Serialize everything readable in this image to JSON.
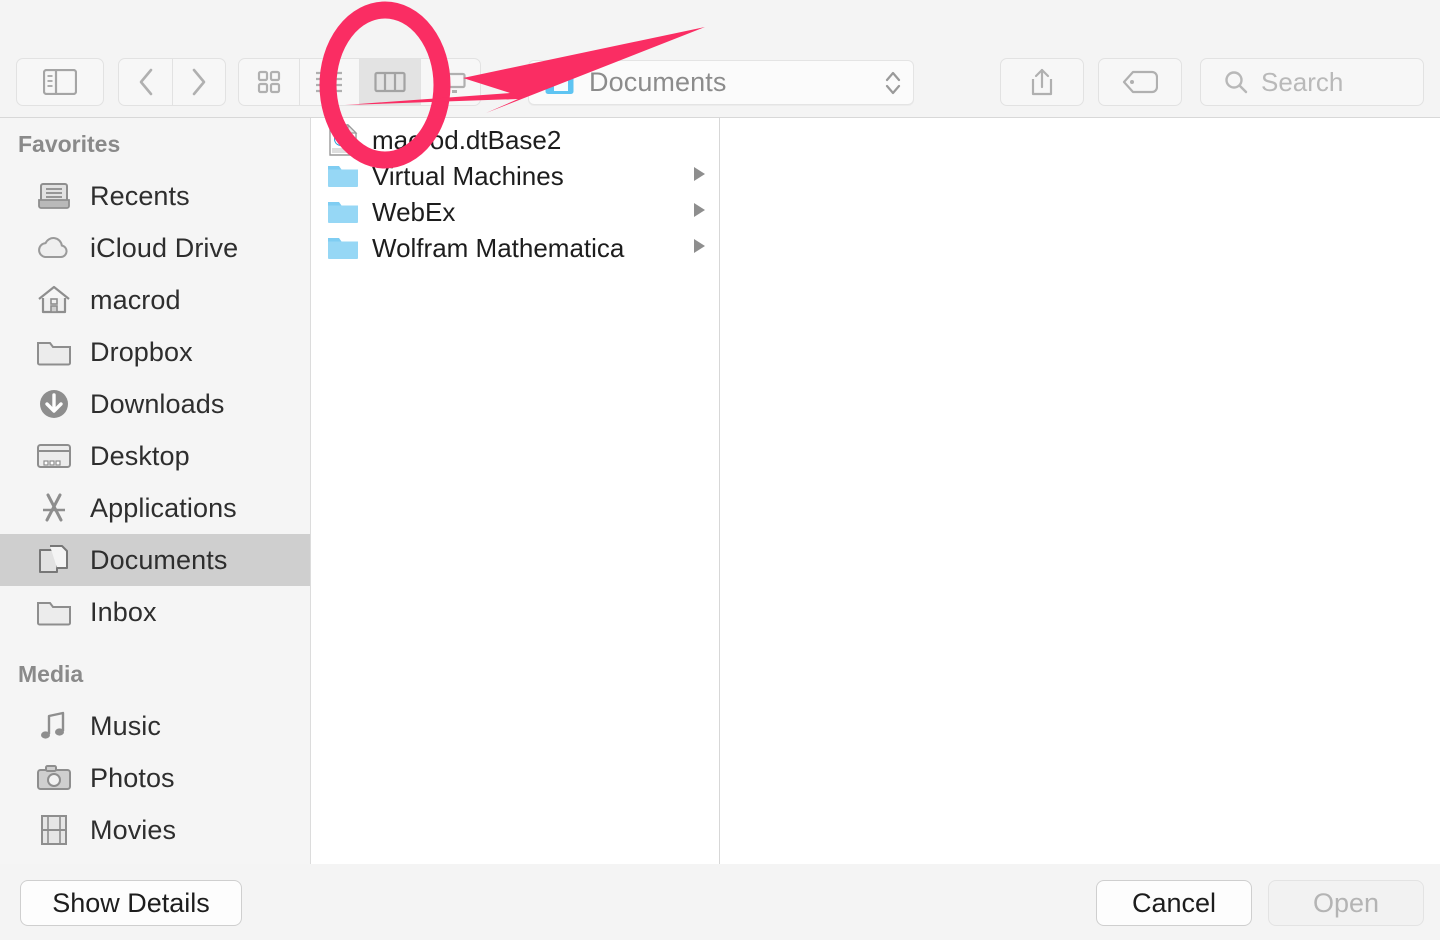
{
  "toolbar": {
    "sidebar_toggle": "sidebar-toggle",
    "back": "back",
    "forward": "forward",
    "view_icon": "icon-view",
    "view_list": "list-view",
    "view_column": "column-view",
    "view_gallery": "gallery-view",
    "path_label": "Documents",
    "share": "share",
    "tags": "tags",
    "search_placeholder": "Search"
  },
  "sidebar": {
    "sections": [
      {
        "title": "Favorites",
        "items": [
          {
            "label": "Recents",
            "icon": "recents-icon",
            "selected": false
          },
          {
            "label": "iCloud Drive",
            "icon": "icloud-icon",
            "selected": false
          },
          {
            "label": "macrod",
            "icon": "home-icon",
            "selected": false
          },
          {
            "label": "Dropbox",
            "icon": "folder-icon",
            "selected": false
          },
          {
            "label": "Downloads",
            "icon": "downloads-icon",
            "selected": false
          },
          {
            "label": "Desktop",
            "icon": "desktop-icon",
            "selected": false
          },
          {
            "label": "Applications",
            "icon": "applications-icon",
            "selected": false
          },
          {
            "label": "Documents",
            "icon": "documents-icon",
            "selected": true
          },
          {
            "label": "Inbox",
            "icon": "folder-icon",
            "selected": false
          }
        ]
      },
      {
        "title": "Media",
        "items": [
          {
            "label": "Music",
            "icon": "music-icon",
            "selected": false
          },
          {
            "label": "Photos",
            "icon": "photos-icon",
            "selected": false
          },
          {
            "label": "Movies",
            "icon": "movies-icon",
            "selected": false
          }
        ]
      }
    ]
  },
  "files": [
    {
      "name": "macrod.dtBase2",
      "icon": "dtbase2-file-icon",
      "has_children": false
    },
    {
      "name": "Virtual Machines",
      "icon": "folder-icon",
      "has_children": true
    },
    {
      "name": "WebEx",
      "icon": "folder-icon",
      "has_children": true
    },
    {
      "name": "Wolfram Mathematica",
      "icon": "folder-icon",
      "has_children": true
    }
  ],
  "bottom": {
    "show_details": "Show Details",
    "cancel": "Cancel",
    "open": "Open"
  },
  "annotation": {
    "color": "#fa2d63",
    "shape": "ellipse-and-arrow",
    "target": "column-view-button"
  }
}
